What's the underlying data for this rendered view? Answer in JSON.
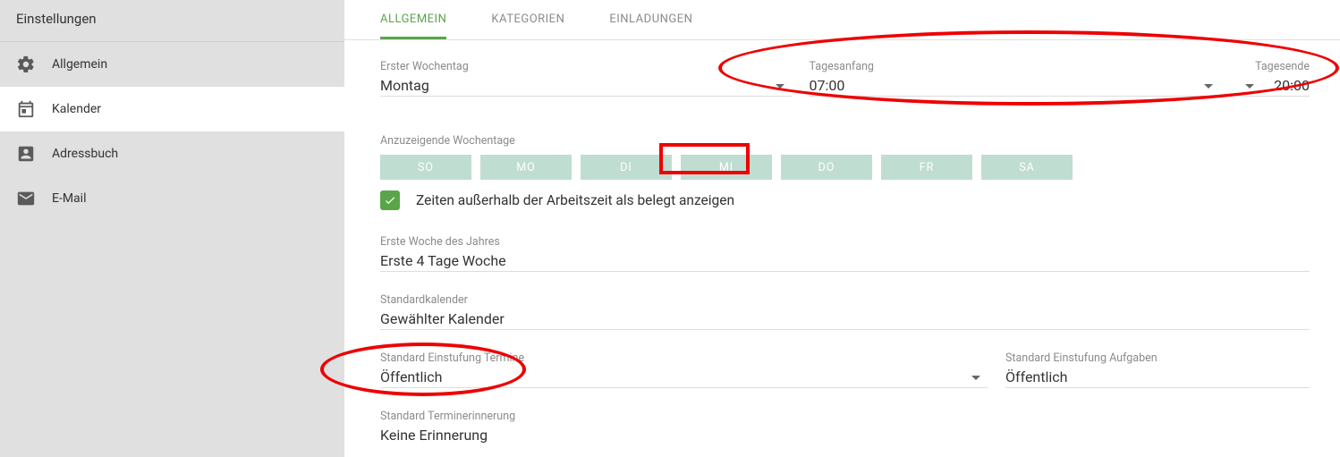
{
  "sidebar": {
    "title": "Einstellungen",
    "items": [
      {
        "label": "Allgemein",
        "active": false,
        "icon": "gear"
      },
      {
        "label": "Kalender",
        "active": true,
        "icon": "calendar"
      },
      {
        "label": "Adressbuch",
        "active": false,
        "icon": "contacts"
      },
      {
        "label": "E-Mail",
        "active": false,
        "icon": "mail"
      }
    ]
  },
  "tabs": [
    {
      "label": "ALLGEMEIN",
      "active": true
    },
    {
      "label": "KATEGORIEN",
      "active": false
    },
    {
      "label": "EINLADUNGEN",
      "active": false
    }
  ],
  "fields": {
    "first_weekday": {
      "label": "Erster Wochentag",
      "value": "Montag"
    },
    "day_start": {
      "label": "Tagesanfang",
      "value": "07:00"
    },
    "day_end": {
      "label": "Tagesende",
      "value": "20:00"
    }
  },
  "weekdays": {
    "label": "Anzuzeigende Wochentage",
    "days": [
      "SO",
      "MO",
      "DI",
      "MI",
      "DO",
      "FR",
      "SA"
    ]
  },
  "checkbox_busy": {
    "checked": true,
    "label": "Zeiten außerhalb der Arbeitszeit als belegt anzeigen"
  },
  "first_week": {
    "label": "Erste Woche des Jahres",
    "value": "Erste 4 Tage Woche"
  },
  "default_calendar": {
    "label": "Standardkalender",
    "value": "Gewählter Kalender"
  },
  "classification": {
    "appointments": {
      "label": "Standard Einstufung Termine",
      "value": "Öffentlich"
    },
    "tasks": {
      "label": "Standard Einstufung Aufgaben",
      "value": "Öffentlich"
    }
  },
  "reminder": {
    "label": "Standard Terminerinnerung",
    "value": "Keine Erinnerung"
  }
}
